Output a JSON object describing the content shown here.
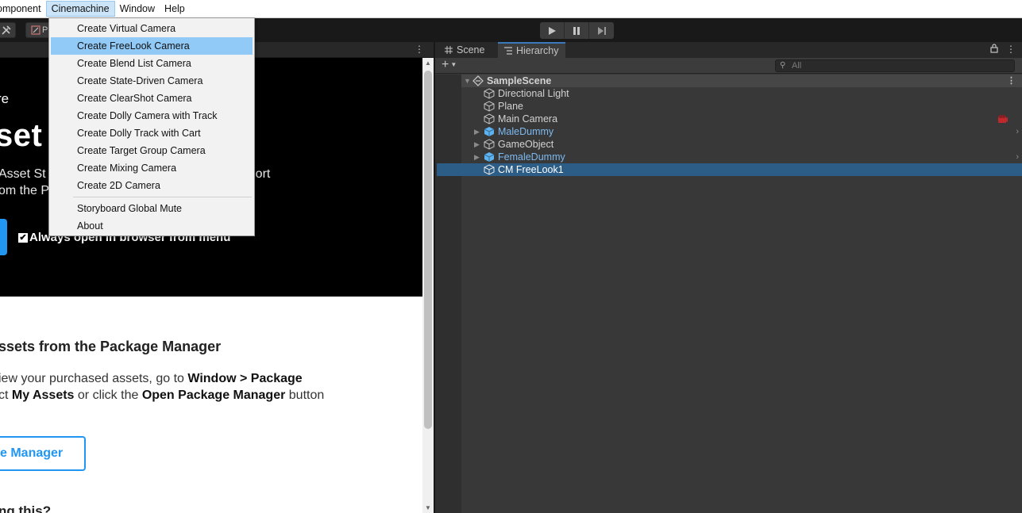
{
  "menubar": {
    "items": [
      "omponent",
      "Cinemachine",
      "Window",
      "Help"
    ]
  },
  "dropdown": {
    "items": [
      "Create Virtual Camera",
      "Create FreeLook Camera",
      "Create Blend List Camera",
      "Create State-Driven Camera",
      "Create ClearShot Camera",
      "Create Dolly Camera with Track",
      "Create Dolly Track with Cart",
      "Create Target Group Camera",
      "Create Mixing Camera",
      "Create 2D Camera"
    ],
    "extra_items": [
      "Storyboard Global Mute",
      "About"
    ],
    "highlighted": "Create FreeLook Camera"
  },
  "toolbar": {
    "tool_label": "P"
  },
  "asset_store": {
    "hero_line1": "re",
    "hero_title": "set          ved",
    "hero_desc": "Asset St                                     , and also import\nom the P",
    "checkbox_label": "Always open in browser from menu",
    "section_title": "ssets from the Package Manager",
    "section_body_l1_a": "iew your purchased assets, go to ",
    "section_body_l1_b": "Window > Package",
    "section_body_l2_a": "ct ",
    "section_body_l2_b": "My Assets",
    "section_body_l2_c": " or click the ",
    "section_body_l2_d": "Open Package Manager",
    "section_body_l2_e": " button",
    "pm_button": "e Manager",
    "footer_cut": "ng this?"
  },
  "hierarchy": {
    "tabs": [
      "Scene",
      "Hierarchy"
    ],
    "search_placeholder": "All",
    "scene_name": "SampleScene",
    "objects": [
      {
        "name": "Directional Light",
        "prefab": false,
        "expandable": false
      },
      {
        "name": "Plane",
        "prefab": false,
        "expandable": false
      },
      {
        "name": "Main Camera",
        "prefab": false,
        "expandable": false
      },
      {
        "name": "MaleDummy",
        "prefab": true,
        "expandable": true
      },
      {
        "name": "GameObject",
        "prefab": false,
        "expandable": true
      },
      {
        "name": "FemaleDummy",
        "prefab": true,
        "expandable": true
      },
      {
        "name": "CM FreeLook1",
        "prefab": false,
        "expandable": false,
        "selected": true
      }
    ]
  },
  "colors": {
    "selection": "#2c5d87",
    "menu_highlight": "#91c9f7",
    "prefab_text": "#7cb9f0",
    "accent_blue": "#2196f3"
  }
}
